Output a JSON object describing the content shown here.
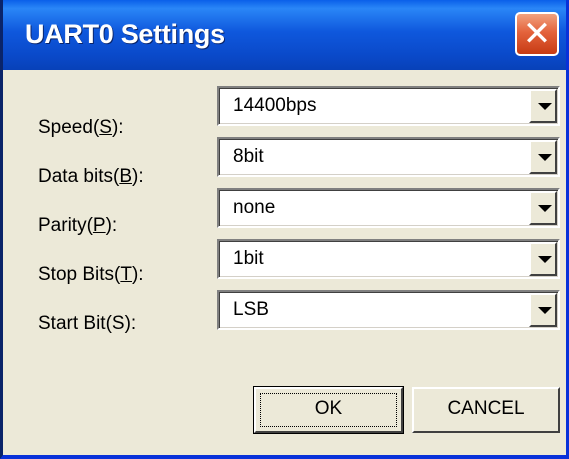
{
  "window": {
    "title": "UART0 Settings",
    "close_glyph": "✕"
  },
  "fields": [
    {
      "label_pre": "Speed(",
      "mnemonic": "S",
      "label_post": "):",
      "value": "14400bps"
    },
    {
      "label_pre": "Data bits(",
      "mnemonic": "B",
      "label_post": "):",
      "value": "8bit"
    },
    {
      "label_pre": "Parity(",
      "mnemonic": "P",
      "label_post": "):",
      "value": "none"
    },
    {
      "label_pre": "Stop Bits(",
      "mnemonic": "T",
      "label_post": "):",
      "value": "1bit"
    },
    {
      "label_pre": "Start Bit(S):",
      "mnemonic": "",
      "label_post": "",
      "value": "LSB"
    }
  ],
  "buttons": {
    "ok": "OK",
    "cancel": "CANCEL"
  }
}
